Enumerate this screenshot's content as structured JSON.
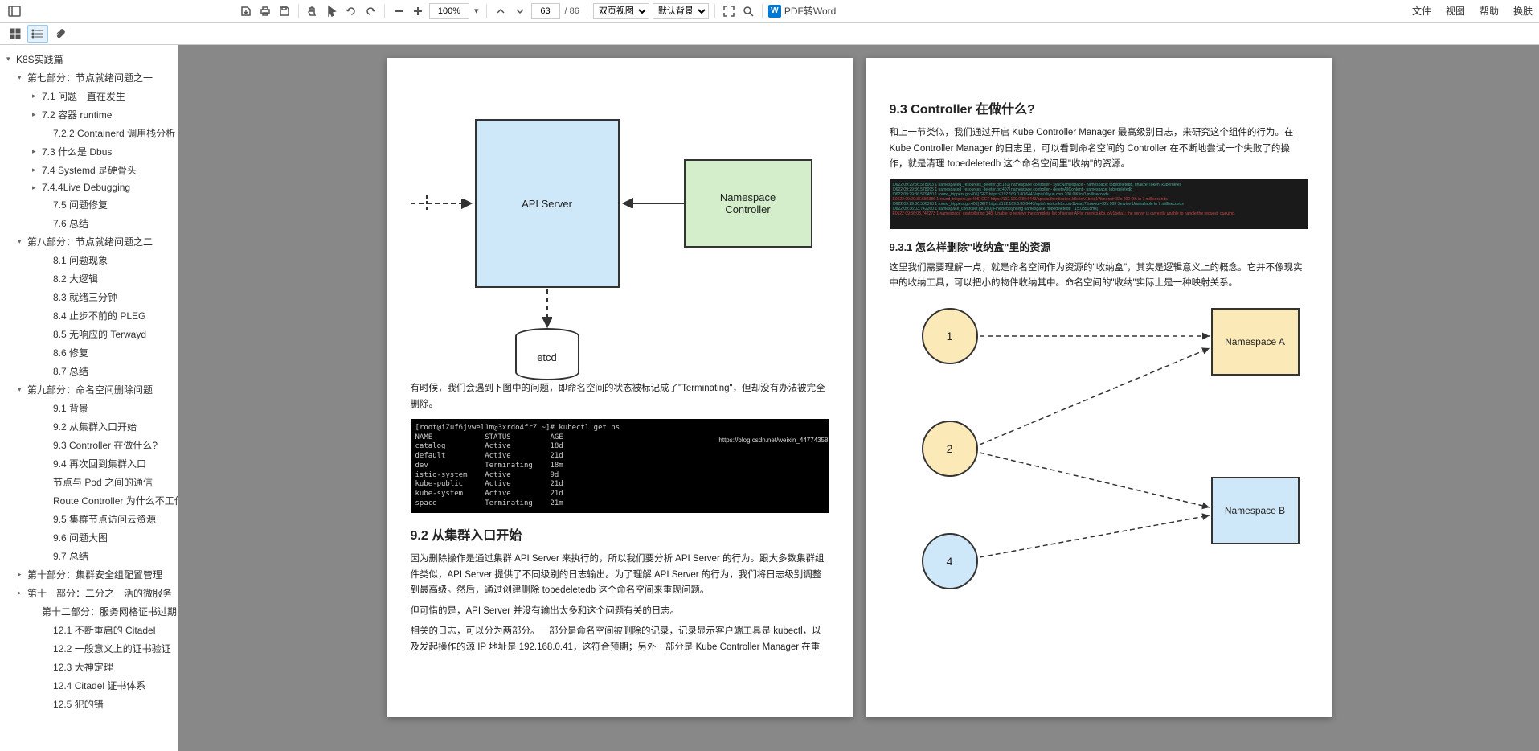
{
  "toolbar": {
    "zoom": "100%",
    "page_current": "63",
    "page_total": "/ 86",
    "view_mode": "双页视图",
    "bg_mode": "默认背景",
    "pdf_to_word": "PDF转Word"
  },
  "menu": {
    "file": "文件",
    "view": "视图",
    "help": "帮助",
    "skin": "换肤"
  },
  "toc": [
    {
      "level": 0,
      "arrow": "▾",
      "label": "K8S实践篇"
    },
    {
      "level": 1,
      "arrow": "▾",
      "label": "第七部分：节点就绪问题之一"
    },
    {
      "level": 2,
      "arrow": "▸",
      "label": "7.1 问题一直在发生"
    },
    {
      "level": 2,
      "arrow": "▸",
      "label": "7.2 容器 runtime"
    },
    {
      "level": 3,
      "arrow": "",
      "label": "7.2.2 Containerd 调用栈分析"
    },
    {
      "level": 2,
      "arrow": "▸",
      "label": "7.3 什么是 Dbus"
    },
    {
      "level": 2,
      "arrow": "▸",
      "label": "7.4 Systemd 是硬骨头"
    },
    {
      "level": 2,
      "arrow": "▸",
      "label": "7.4.4Live Debugging"
    },
    {
      "level": 3,
      "arrow": "",
      "label": "7.5 问题修复"
    },
    {
      "level": 3,
      "arrow": "",
      "label": "7.6 总结"
    },
    {
      "level": 1,
      "arrow": "▾",
      "label": "第八部分：节点就绪问题之二"
    },
    {
      "level": 3,
      "arrow": "",
      "label": "8.1 问题现象"
    },
    {
      "level": 3,
      "arrow": "",
      "label": "8.2 大逻辑"
    },
    {
      "level": 3,
      "arrow": "",
      "label": "8.3 就绪三分钟"
    },
    {
      "level": 3,
      "arrow": "",
      "label": "8.4 止步不前的 PLEG"
    },
    {
      "level": 3,
      "arrow": "",
      "label": "8.5 无响应的 Terwayd"
    },
    {
      "level": 3,
      "arrow": "",
      "label": "8.6 修复"
    },
    {
      "level": 3,
      "arrow": "",
      "label": "8.7 总结"
    },
    {
      "level": 1,
      "arrow": "▾",
      "label": "第九部分：命名空间删除问题"
    },
    {
      "level": 3,
      "arrow": "",
      "label": "9.1 背景"
    },
    {
      "level": 3,
      "arrow": "",
      "label": "9.2 从集群入口开始"
    },
    {
      "level": 3,
      "arrow": "",
      "label": "9.3 Controller 在做什么?"
    },
    {
      "level": 3,
      "arrow": "",
      "label": "9.4 再次回到集群入口"
    },
    {
      "level": 3,
      "arrow": "",
      "label": "节点与 Pod 之间的通信"
    },
    {
      "level": 3,
      "arrow": "",
      "label": "Route Controller 为什么不工作?"
    },
    {
      "level": 3,
      "arrow": "",
      "label": "9.5 集群节点访问云资源"
    },
    {
      "level": 3,
      "arrow": "",
      "label": "9.6 问题大图"
    },
    {
      "level": 3,
      "arrow": "",
      "label": "9.7 总结"
    },
    {
      "level": 1,
      "arrow": "▸",
      "label": "第十部分：集群安全组配置管理"
    },
    {
      "level": 1,
      "arrow": "▸",
      "label": "第十一部分：二分之一活的微服务"
    },
    {
      "level": 2,
      "arrow": "",
      "label": "第十二部分：服务网格证书过期问题"
    },
    {
      "level": 3,
      "arrow": "",
      "label": "12.1 不断重启的 Citadel"
    },
    {
      "level": 3,
      "arrow": "",
      "label": "12.2 一般意义上的证书验证"
    },
    {
      "level": 3,
      "arrow": "",
      "label": "12.3 大神定理"
    },
    {
      "level": 3,
      "arrow": "",
      "label": "12.4 Citadel 证书体系"
    },
    {
      "level": 3,
      "arrow": "",
      "label": "12.5 犯的错"
    }
  ],
  "left_page": {
    "diagram": {
      "api": "API Server",
      "ns": "Namespace\nController",
      "etcd": "etcd"
    },
    "p1": "有时候，我们会遇到下图中的问题，即命名空间的状态被标记成了\"Terminating\"，但却没有办法被完全删除。",
    "terminal": "[root@iZuf6jvwel1m@3xrdo4frZ ~]# kubectl get ns\nNAME            STATUS         AGE\ncatalog         Active         18d\ndefault         Active         21d\ndev             Terminating    18m\nistio-system    Active         9d\nkube-public     Active         21d\nkube-system     Active         21d\nspace           Terminating    21m",
    "h2": "9.2 从集群入口开始",
    "p2": "因为删除操作是通过集群 API Server 来执行的，所以我们要分析 API Server 的行为。跟大多数集群组件类似，API Server 提供了不同级别的日志输出。为了理解 API Server 的行为，我们将日志级别调整到最高级。然后，通过创建删除 tobedeletedb 这个命名空间来重现问题。",
    "p3": "但可惜的是，API Server 并没有输出太多和这个问题有关的日志。",
    "p4": "相关的日志，可以分为两部分。一部分是命名空间被删除的记录，记录显示客户端工具是 kubectl，以及发起操作的源 IP 地址是 192.168.0.41，这符合预期；另外一部分是 Kube Controller Manager 在重"
  },
  "right_page": {
    "h2": "9.3 Controller 在做什么?",
    "p1": "和上一节类似，我们通过开启 Kube Controller Manager 最高级别日志，来研究这个组件的行为。在 Kube Controller Manager 的日志里，可以看到命名空间的 Controller 在不断地尝试一个失败了的操作，就是清理 tobedeletedb 这个命名空间里\"收纳\"的资源。",
    "h3": "9.3.1 怎么样删除\"收纳盒\"里的资源",
    "p2": "这里我们需要理解一点，就是命名空间作为资源的\"收纳盒\"，其实是逻辑意义上的概念。它并不像现实中的收纳工具，可以把小的物件收纳其中。命名空间的\"收纳\"实际上是一种映射关系。",
    "diagram": {
      "c1": "1",
      "c2": "2",
      "c4": "4",
      "na": "Namespace A",
      "nb": "Namespace B"
    },
    "log_lines": [
      "I0622 09:29:36.578063   1 namespaced_resources_deleter.go:131] namespace controller - syncNamespace - namespace: tobedeletedb, finalizerToken: kubernetes",
      "I0622 09:29:36.578095   1 namespaced_resources_deleter.go:407] namespace controller - deleteAllContent - namespace: tobedeletedb",
      "I0622 09:29:36.579450   1 round_trippers.go:405] GET https://192.169.0.80:6443/apis/aliyun.com 200 OK in 0 milliseconds",
      "E0622 09:29:36.582386   1 round_trippers.go:405] GET https://192.169.0.80:6443/apis/authentication.k8s.io/v1beta1?timeout=32s 200 OK in 7 milliseconds",
      "I0622 09:29:36.586378   1 round_trippers.go:405] GET https://192.169.0.80:6443/apis/metrics.k8s.io/v1beta1?timeout=32s 503 Service Unavailable in 7 milliseconds",
      "I0622 09:36:03.742260   1 namespace_controller.go:160] Finished syncing namespace \"tobedeletedb\" (15.03518ms)",
      "E0622 09:36:03.742273   1 namespace_controller.go:148] Unable to retrieve the complete list of server APIs: metrics.k8s.io/v1beta1: the server is currently unable to handle the request, queuing."
    ]
  }
}
